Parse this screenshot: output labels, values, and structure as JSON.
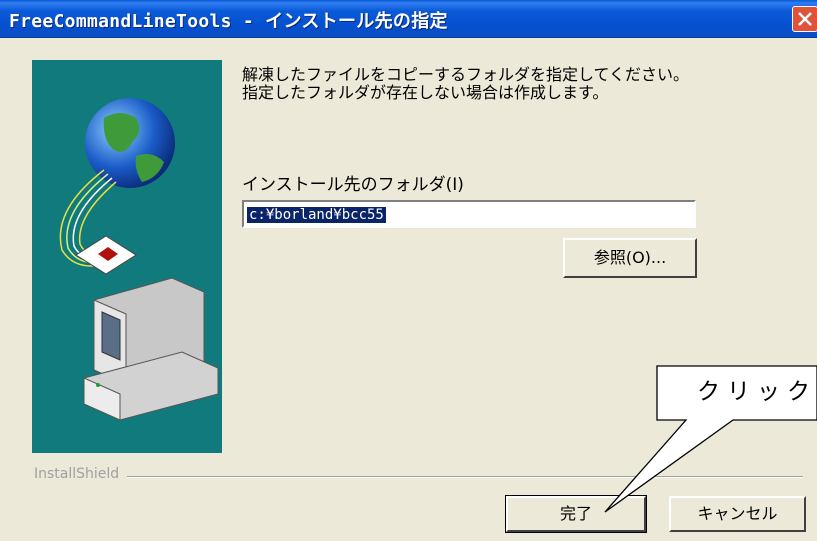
{
  "window": {
    "title": "FreeCommandLineTools - インストール先の指定",
    "close_icon": "close-icon"
  },
  "content": {
    "instructions": "解凍したファイルをコピーするフォルダを指定してください。指定したフォルダが存在しない場合は作成します。",
    "folder_label": "インストール先のフォルダ(I)",
    "folder_value": "c:¥borland¥bcc55",
    "browse_label": "参照(O)..."
  },
  "footer": {
    "brand": "InstallShield",
    "finish_label": "完了",
    "cancel_label": "キャンセル"
  },
  "annotation": {
    "callout_text": "クリック"
  },
  "colors": {
    "titlebar": "#0a5ad8",
    "banner": "#117a7c",
    "dialog_bg": "#ece9d8",
    "selection": "#0a246a",
    "close_button": "#e0533a"
  }
}
